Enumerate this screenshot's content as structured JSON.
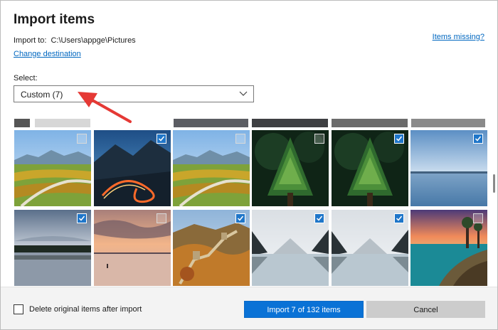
{
  "dialog": {
    "title": "Import items",
    "import_to_label": "Import to:",
    "import_path": "C:\\Users\\appge\\Pictures",
    "change_destination": "Change destination",
    "items_missing": "Items missing?",
    "select_label": "Select:",
    "select_value": "Custom (7)"
  },
  "photos": [
    {
      "scene": "meadow-mountain",
      "selected": false
    },
    {
      "scene": "night-road",
      "selected": true
    },
    {
      "scene": "meadow-mountain",
      "selected": false
    },
    {
      "scene": "green-pine",
      "selected": false
    },
    {
      "scene": "green-pine",
      "selected": true
    },
    {
      "scene": "blue-lake",
      "selected": true
    },
    {
      "scene": "grey-lake",
      "selected": true
    },
    {
      "scene": "sunset-lake",
      "selected": false
    },
    {
      "scene": "great-wall-autumn",
      "selected": true
    },
    {
      "scene": "mountain-lake",
      "selected": true
    },
    {
      "scene": "mountain-lake",
      "selected": true
    },
    {
      "scene": "coast-sunset",
      "selected": false
    }
  ],
  "footer": {
    "delete_label": "Delete original items after import",
    "delete_checked": false,
    "import_button": "Import 7 of 132 items",
    "cancel_button": "Cancel"
  },
  "colors": {
    "accent": "#0a72d6",
    "selection_border": "#2a7ed0",
    "link": "#0067c0",
    "annotation_arrow": "#e53935"
  }
}
